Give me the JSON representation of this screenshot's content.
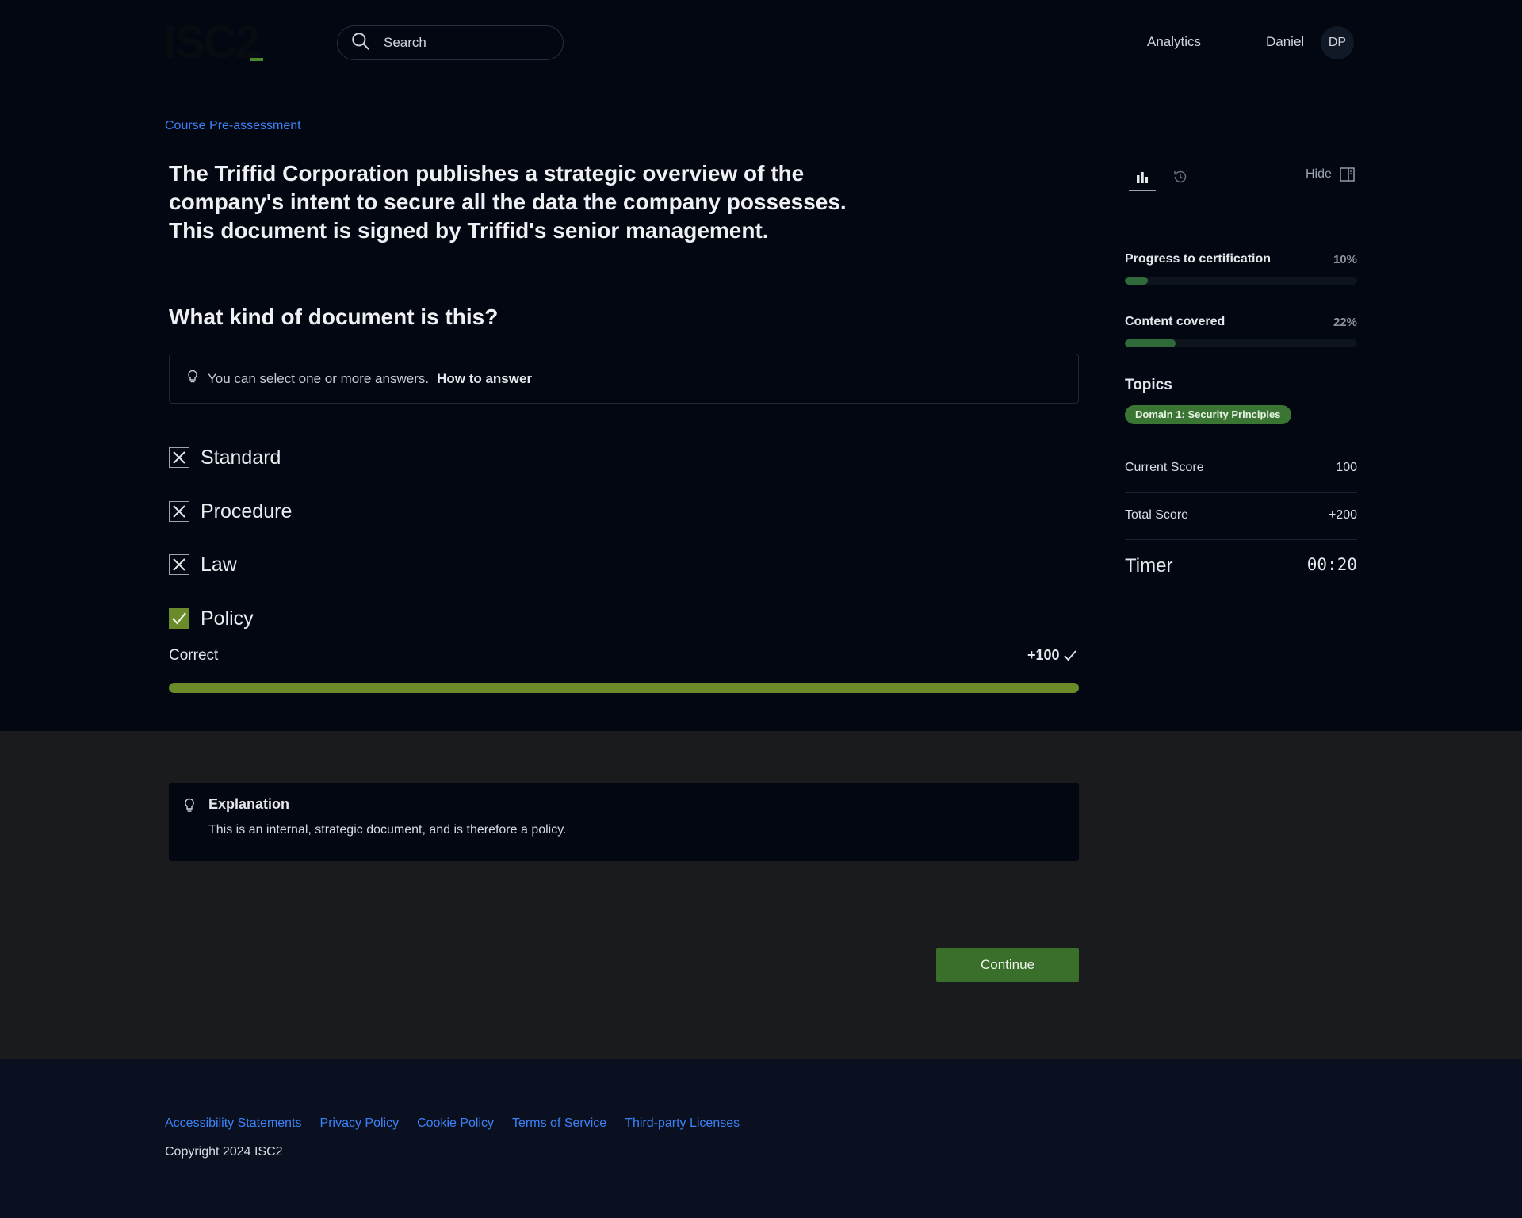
{
  "header": {
    "logo": "ISC2",
    "search_placeholder": "Search",
    "nav_analytics": "Analytics",
    "user_name": "Daniel",
    "user_initials": "DP"
  },
  "main": {
    "breadcrumb": "Course Pre-assessment",
    "question": "The Triffid Corporation publishes a strategic overview of the company's intent to secure all the data the company possesses. This document is signed by Triffid's senior management.",
    "subquestion": "What kind of document is this?",
    "hint_text": "You can select one or more answers.",
    "hint_link": "How to answer",
    "options": [
      {
        "label": "Standard",
        "state": "incorrect"
      },
      {
        "label": "Procedure",
        "state": "incorrect"
      },
      {
        "label": "Law",
        "state": "incorrect"
      },
      {
        "label": "Policy",
        "state": "correct"
      }
    ],
    "result_label": "Correct",
    "result_points": "+100",
    "result_fill_fraction": 1.0,
    "result_color": "#6b8a2a"
  },
  "sidebar": {
    "hide_label": "Hide",
    "progress_label": "Progress to certification",
    "progress_value": "10%",
    "progress_fraction": 0.1,
    "content_label": "Content covered",
    "content_value": "22%",
    "content_fraction": 0.22,
    "topics_title": "Topics",
    "topic_chip": "Domain 1: Security Principles",
    "current_score_label": "Current Score",
    "current_score_value": "100",
    "total_score_label": "Total Score",
    "total_score_value": "+200",
    "timer_label": "Timer",
    "timer_value": "00:20"
  },
  "explanation": {
    "title": "Explanation",
    "text": "This is an internal, strategic document, and is therefore a policy."
  },
  "actions": {
    "continue_label": "Continue"
  },
  "footer": {
    "links": [
      "Accessibility Statements",
      "Privacy Policy",
      "Cookie Policy",
      "Terms of Service",
      "Third-party Licenses"
    ],
    "copyright": "Copyright 2024 ISC2"
  },
  "colors": {
    "accent_link": "#3b82f6",
    "correct_green": "#6b8a2a",
    "button_green": "#3a6e2b",
    "progress_green": "#2f6a3a"
  }
}
